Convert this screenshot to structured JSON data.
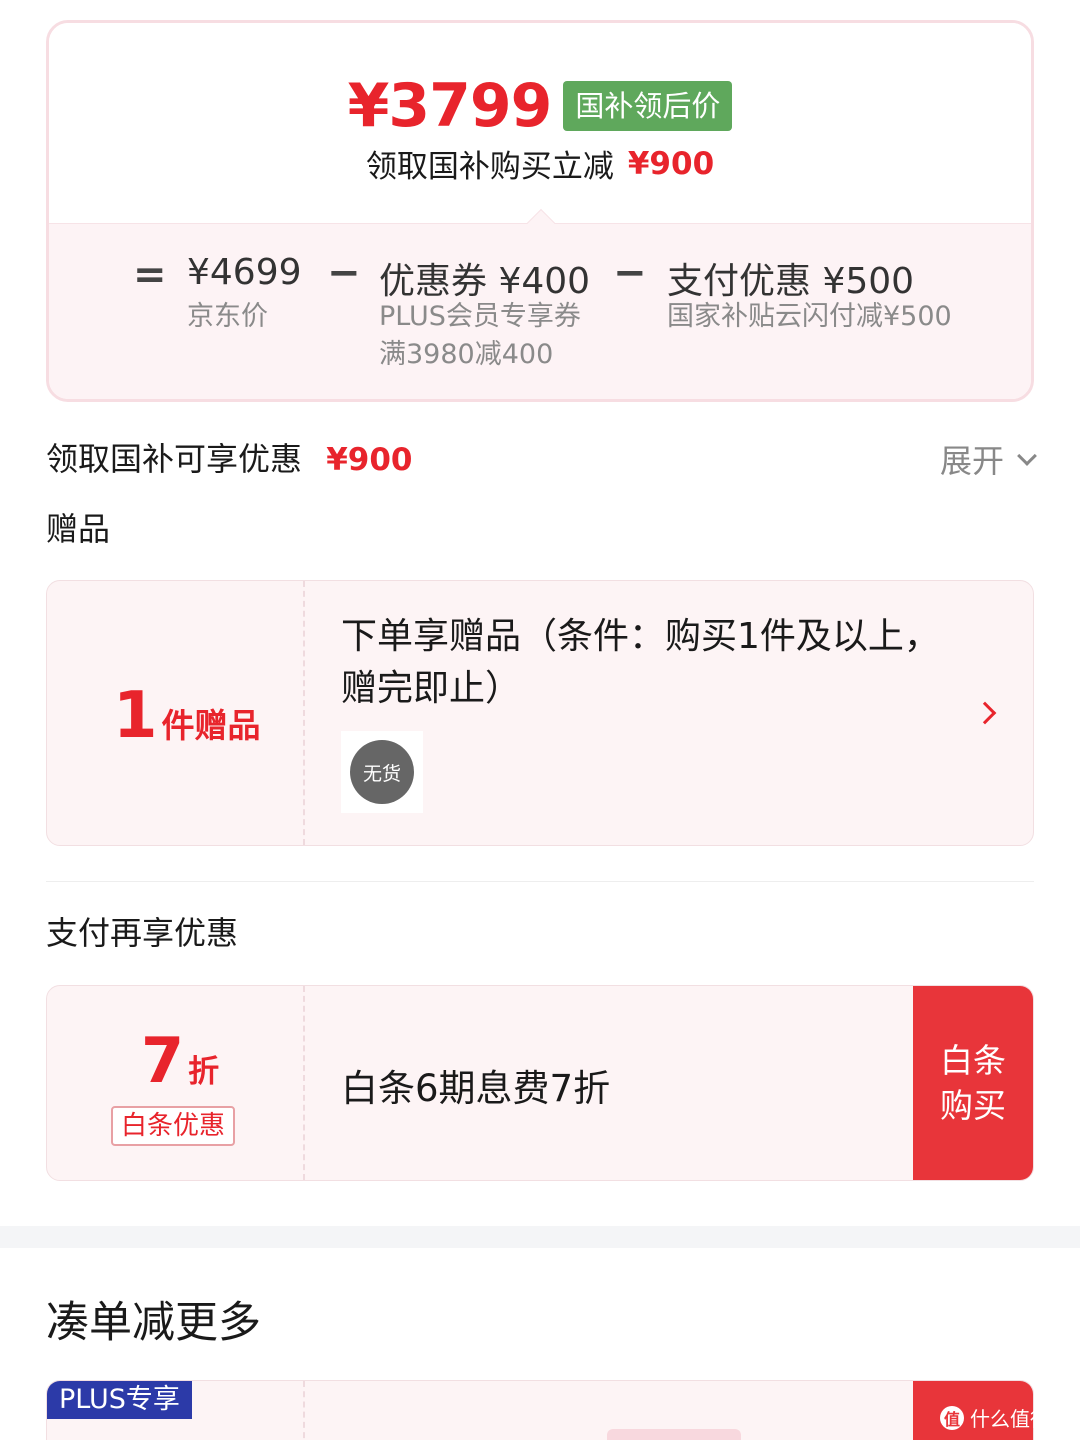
{
  "price_summary": {
    "final_price": "¥3799",
    "final_price_tag": "国补领后价",
    "subsidy_text": "领取国补购买立减",
    "subsidy_amount": "¥900",
    "breakdown": {
      "equals": "=",
      "minus": "−",
      "jd_price": "¥4699",
      "jd_price_label": "京东价",
      "coupon": "优惠券 ¥400",
      "coupon_desc_1": "PLUS会员专享券",
      "coupon_desc_2": "满3980减400",
      "payment": "支付优惠 ¥500",
      "payment_desc": "国家补贴云闪付减¥500"
    }
  },
  "subsidy_row": {
    "label": "领取国补可享优惠",
    "amount": "¥900",
    "expand_label": "展开"
  },
  "gifts": {
    "section_title": "赠品",
    "count": "1",
    "count_unit": "件赠品",
    "title": "下单享赠品（条件：购买1件及以上，赠完即止）",
    "stock_status": "无货"
  },
  "payment_offer": {
    "section_title": "支付再享优惠",
    "discount_value": "7",
    "discount_unit": "折",
    "discount_tag": "白条优惠",
    "title": "白条6期息费7折",
    "button": "白条购买"
  },
  "bundle": {
    "section_title": "凑单减更多",
    "badge": "PLUS专享"
  },
  "watermark": {
    "text": "什么值得买",
    "logo": "值"
  },
  "colors": {
    "accent_red": "#e8242c",
    "tag_green": "#5fa85c",
    "plus_blue": "#2c3aa8",
    "card_pink": "#fdf4f5"
  }
}
